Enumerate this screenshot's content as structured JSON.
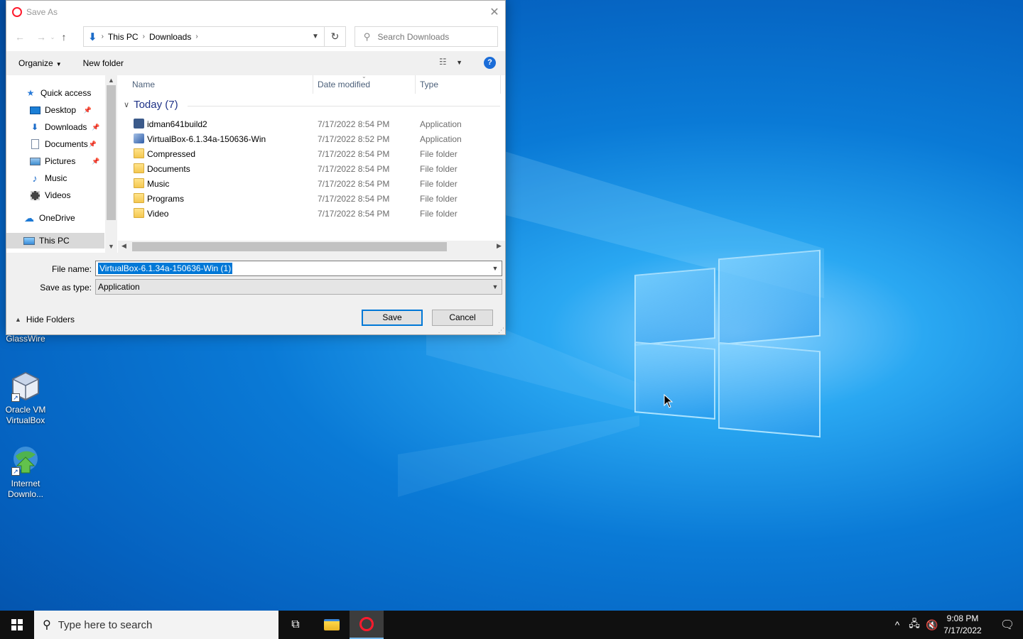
{
  "dialog": {
    "title": "Save As",
    "breadcrumbs": [
      "This PC",
      "Downloads"
    ],
    "search_placeholder": "Search Downloads",
    "toolbar": {
      "organize": "Organize",
      "new_folder": "New folder"
    },
    "nav": {
      "items": [
        {
          "label": "Quick access",
          "icon": "star-icon",
          "pinned": false
        },
        {
          "label": "Desktop",
          "icon": "desktop-icon",
          "pinned": true
        },
        {
          "label": "Downloads",
          "icon": "download-arrow-icon",
          "pinned": true
        },
        {
          "label": "Documents",
          "icon": "document-icon",
          "pinned": true
        },
        {
          "label": "Pictures",
          "icon": "pictures-icon",
          "pinned": true
        },
        {
          "label": "Music",
          "icon": "music-note-icon",
          "pinned": false
        },
        {
          "label": "Videos",
          "icon": "film-icon",
          "pinned": false
        },
        {
          "label": "OneDrive",
          "icon": "cloud-icon",
          "pinned": false
        },
        {
          "label": "This PC",
          "icon": "computer-icon",
          "pinned": false
        }
      ]
    },
    "columns": {
      "name": "Name",
      "date": "Date modified",
      "type": "Type"
    },
    "group_label": "Today (7)",
    "files": [
      {
        "name": "idman641build2",
        "date": "7/17/2022 8:54 PM",
        "type": "Application",
        "icon": "installer-icon"
      },
      {
        "name": "VirtualBox-6.1.34a-150636-Win",
        "date": "7/17/2022 8:52 PM",
        "type": "Application",
        "icon": "virtualbox-icon"
      },
      {
        "name": "Compressed",
        "date": "7/17/2022 8:54 PM",
        "type": "File folder",
        "icon": "folder-icon"
      },
      {
        "name": "Documents",
        "date": "7/17/2022 8:54 PM",
        "type": "File folder",
        "icon": "folder-icon"
      },
      {
        "name": "Music",
        "date": "7/17/2022 8:54 PM",
        "type": "File folder",
        "icon": "folder-icon"
      },
      {
        "name": "Programs",
        "date": "7/17/2022 8:54 PM",
        "type": "File folder",
        "icon": "folder-icon"
      },
      {
        "name": "Video",
        "date": "7/17/2022 8:54 PM",
        "type": "File folder",
        "icon": "folder-icon"
      }
    ],
    "form": {
      "file_name_label": "File name:",
      "file_name_value": "VirtualBox-6.1.34a-150636-Win (1)",
      "save_type_label": "Save as type:",
      "save_type_value": "Application",
      "hide_folders": "Hide Folders",
      "save": "Save",
      "cancel": "Cancel"
    }
  },
  "desktop": {
    "icons": [
      {
        "label": "GlassWire"
      },
      {
        "label": "Oracle VM VirtualBox"
      },
      {
        "label": "Internet Downlo..."
      }
    ]
  },
  "taskbar": {
    "search_placeholder": "Type here to search",
    "time": "9:08 PM",
    "date": "7/17/2022"
  },
  "colors": {
    "accent": "#0078d7",
    "desktop_blue": "#0a7ad6",
    "opera_red": "#ff1b2d"
  }
}
